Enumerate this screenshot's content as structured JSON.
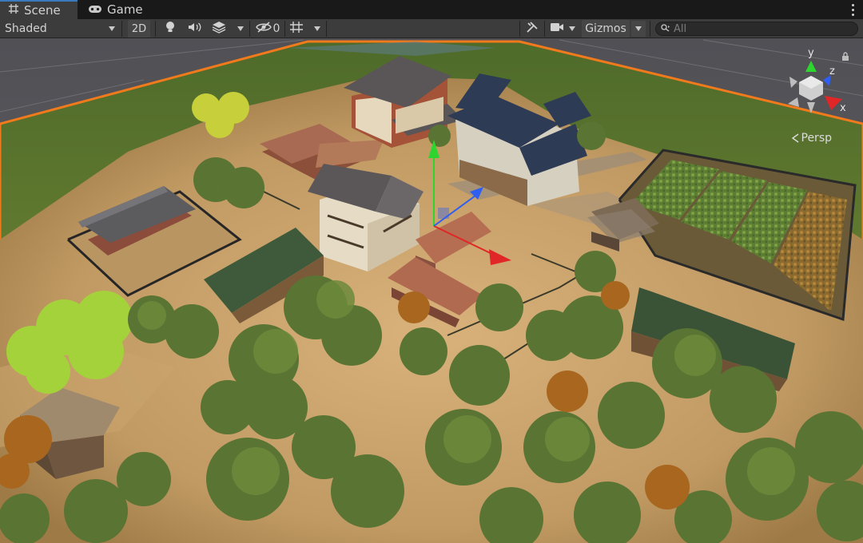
{
  "tabs": [
    {
      "label": "Scene",
      "icon": "scene-grid-icon",
      "active": true
    },
    {
      "label": "Game",
      "icon": "gamepad-icon",
      "active": false
    }
  ],
  "toolbar": {
    "draw_mode": "Shaded",
    "mode_2d": "2D",
    "hidden_count": "0",
    "gizmos_label": "Gizmos",
    "search_placeholder": "All"
  },
  "gizmo": {
    "axis_y": "y",
    "axis_x": "x",
    "axis_z": "z",
    "projection_label": "Persp"
  },
  "colors": {
    "selection_outline": "#f07a1c",
    "axis_x": "#e02626",
    "axis_y": "#2fd52f",
    "axis_z": "#2f5ff0",
    "ground": "#c5a069",
    "grass": "#647c30"
  }
}
